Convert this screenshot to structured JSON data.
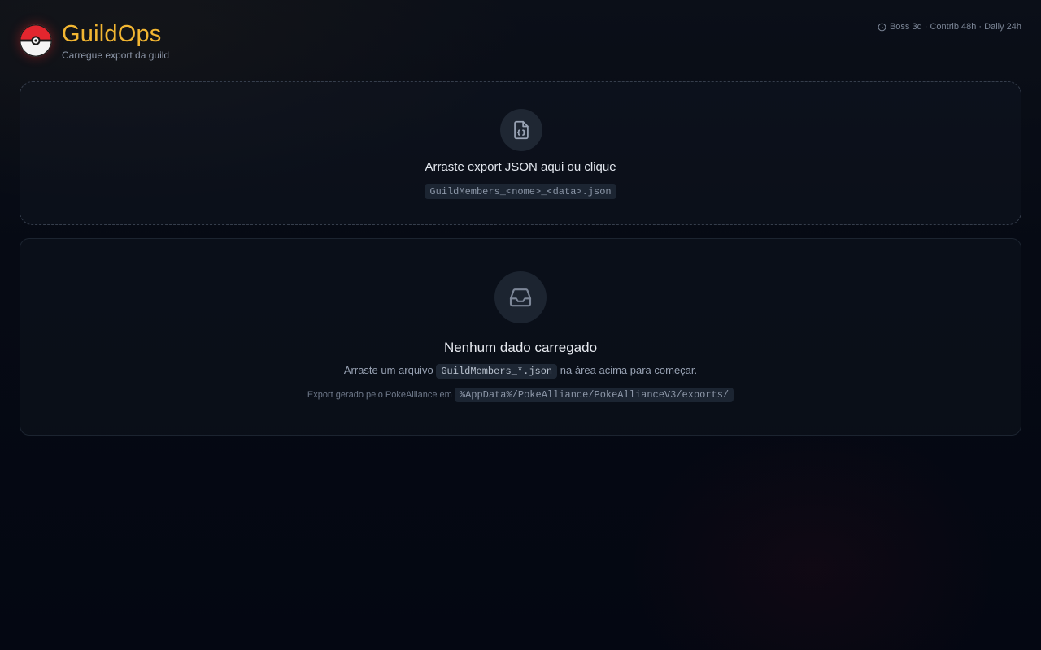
{
  "header": {
    "title": "GuildOps",
    "subtitle": "Carregue export da guild",
    "logo_icon": "pokeball-icon",
    "timers_icon": "clock-icon",
    "timers": "Boss 3d · Contrib 48h · Daily 24h"
  },
  "dropzone": {
    "icon": "file-json-icon",
    "title": "Arraste export JSON aqui ou clique",
    "filename_hint": "GuildMembers_<nome>_<data>.json"
  },
  "empty_state": {
    "icon": "inbox-icon",
    "title": "Nenhum dado carregado",
    "desc_before": "Arraste um arquivo",
    "desc_code": "GuildMembers_*.json",
    "desc_after": "na área acima para começar.",
    "note_before": "Export gerado pelo PokeAlliance em",
    "note_path": "%AppData%/PokeAlliance/PokeAllianceV3/exports/"
  },
  "colors": {
    "brand": "#f2b632",
    "background": "#060a14",
    "pokeball_red": "#e3262e"
  }
}
